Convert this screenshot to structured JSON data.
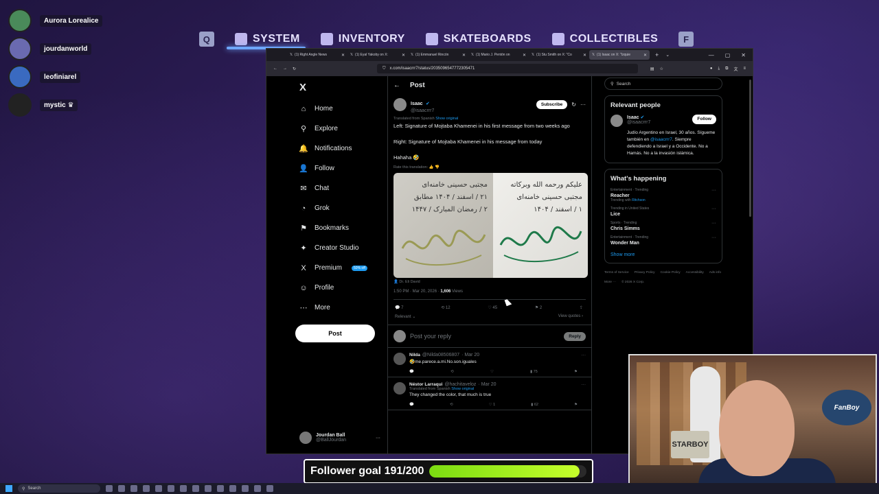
{
  "discord": {
    "users": [
      {
        "name": "Aurora Lorealice",
        "color": "#4a8a5a"
      },
      {
        "name": "jourdanworld",
        "color": "#6a6ab0"
      },
      {
        "name": "leofiniarel",
        "color": "#3a6ac0"
      },
      {
        "name": "mystic ♛",
        "color": "#222222"
      }
    ]
  },
  "game_menu": {
    "left_key": "Q",
    "right_key": "F",
    "items": [
      "SYSTEM",
      "INVENTORY",
      "SKATEBOARDS",
      "COLLECTIBLES"
    ]
  },
  "browser": {
    "tabs": [
      "(1) Right Angle News",
      "(1) Eyal Yakoby on X:",
      "(1) Emmanuel Rincón",
      "(1) Mario J. Pentón on",
      "(1) Stu Smith on X: \"Co",
      "(1) Isaac on X: \"Izquie"
    ],
    "url": "x.com/isaacrrr7/status/2035096547772305471"
  },
  "nav": {
    "logo": "X",
    "items": [
      {
        "label": "Home",
        "icon": "⌂"
      },
      {
        "label": "Explore",
        "icon": "⚲"
      },
      {
        "label": "Notifications",
        "icon": "🔔"
      },
      {
        "label": "Follow",
        "icon": "👤"
      },
      {
        "label": "Chat",
        "icon": "✉"
      },
      {
        "label": "Grok",
        "icon": "◔"
      },
      {
        "label": "Bookmarks",
        "icon": "⚑"
      },
      {
        "label": "Creator Studio",
        "icon": "✦"
      },
      {
        "label": "Premium",
        "icon": "X"
      },
      {
        "label": "Profile",
        "icon": "☺"
      },
      {
        "label": "More",
        "icon": "⋯"
      }
    ],
    "premium_badge": "50% off",
    "post_button": "Post",
    "account": {
      "name": "Jourdan Ball",
      "handle": "@BallJourdan"
    }
  },
  "post": {
    "header": "Post",
    "author_name": "Isaac",
    "author_handle": "@isaacrrr7",
    "subscribe_label": "Subscribe",
    "translated_note": "Translated from Spanish",
    "show_original": "Show original",
    "text1": "Left: Signature of Mojtaba Khamenei in his first message from two weeks ago",
    "text2": "Right: Signature of Mojtaba Khamenei in his message from today",
    "text3": "Hahaha 🤣",
    "rate_translation": "Rate this translation:",
    "media_left_lines": [
      "مجتبی حسینی خامنه‌ای",
      "۲۱ / اسفند / ۱۴۰۴ مطابق",
      "۲ / رمضان المبارک / ۱۴۴۷"
    ],
    "media_right_lines": [
      "علیکم ورحمه الله وبرکاته",
      "مجتبی حسینی خامنه‌ای",
      "۱ / اسفند / ۱۴۰۴"
    ],
    "media_credit": "Dr. Eli David",
    "timestamp": "1:50 PM · Mar 20, 2026 · ",
    "views_count": "1,606",
    "views_label": " Views",
    "replies": "7",
    "reposts": "12",
    "likes": "45",
    "bookmarks": "2",
    "relevant_label": "Relevant",
    "view_quotes": "View quotes",
    "reply_placeholder": "Post your reply",
    "reply_button": "Reply"
  },
  "comments": [
    {
      "name": "Nilda",
      "handle": "@Nilda08506807",
      "date": "· Mar 20",
      "translated": "",
      "show_original": "",
      "text": "🤣me.parece.a.mi.No.son.iguales",
      "views": "75",
      "likes": ""
    },
    {
      "name": "Néstor Larraqui",
      "handle": "@hachitaveloz",
      "date": "· Mar 20",
      "translated": "Translated from Spanish",
      "show_original": "Show original",
      "text": "They changed the color, that much is true",
      "views": "62",
      "likes": "1"
    }
  ],
  "right": {
    "search_placeholder": "Search",
    "relevant_people_title": "Relevant people",
    "person": {
      "name": "Isaac",
      "handle": "@isaacrrr7",
      "follow": "Follow",
      "bio_pre": "Judío Argentino en Israel, 30 años. Sígueme también en ",
      "bio_link": "@isaacrrr7",
      "bio_post": ". Siempre defendiendo a Israel y a Occidente. No a Hamás. No a la invasión islámica."
    },
    "happening_title": "What's happening",
    "trends": [
      {
        "cat": "Entertainment · Trending",
        "name": "Reacher",
        "with_pre": "Trending with ",
        "with_link": "Ritchson"
      },
      {
        "cat": "Trending in United States",
        "name": "Lice",
        "with_pre": "",
        "with_link": ""
      },
      {
        "cat": "Sports · Trending",
        "name": "Chris Simms",
        "with_pre": "",
        "with_link": ""
      },
      {
        "cat": "Entertainment · Trending",
        "name": "Wonder Man",
        "with_pre": "",
        "with_link": ""
      }
    ],
    "show_more": "Show more",
    "footer": [
      "Terms of Service",
      "Privacy Policy",
      "Cookie Policy",
      "Accessibility",
      "Ads info",
      "More ···",
      "© 2026 X Corp."
    ]
  },
  "webcam": {
    "sign_text": "STARBOY",
    "logo_text": "FanBoy"
  },
  "follower_goal": {
    "label": "Follower goal 191/200",
    "progress": 0.955
  },
  "taskbar": {
    "search": "Search"
  }
}
